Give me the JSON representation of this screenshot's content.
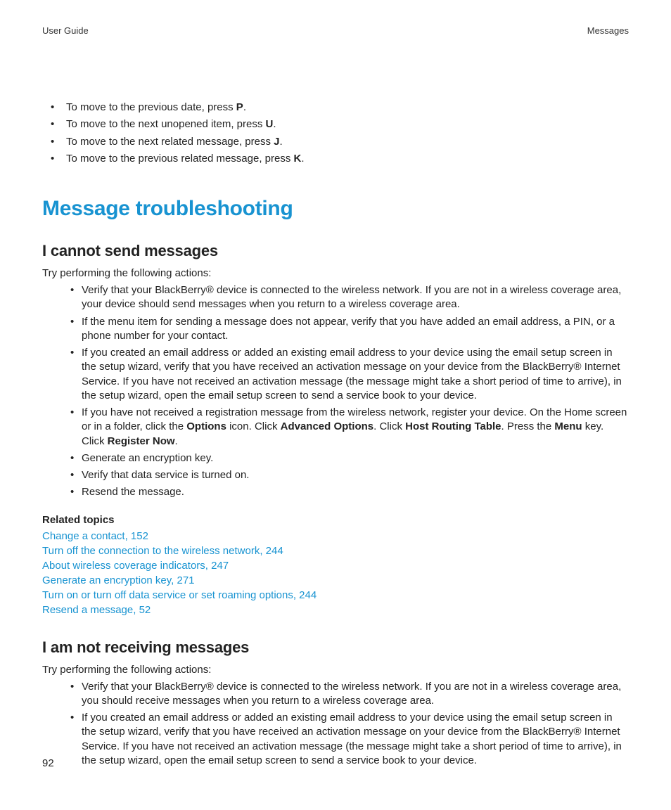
{
  "header": {
    "left": "User Guide",
    "right": "Messages"
  },
  "tips": [
    {
      "prefix": "To move to the previous date, press ",
      "key": "P",
      "suffix": "."
    },
    {
      "prefix": "To move to the next unopened item, press ",
      "key": "U",
      "suffix": "."
    },
    {
      "prefix": "To move to the next related message, press ",
      "key": "J",
      "suffix": "."
    },
    {
      "prefix": "To move to the previous related message, press ",
      "key": "K",
      "suffix": "."
    }
  ],
  "troubleshooting": {
    "title": "Message troubleshooting",
    "sections": [
      {
        "heading": "I cannot send messages",
        "intro": "Try performing the following actions:",
        "items": [
          {
            "text": "Verify that your BlackBerry® device is connected to the wireless network. If you are not in a wireless coverage area, your device should send messages when you return to a wireless coverage area."
          },
          {
            "text": "If the menu item for sending a message does not appear, verify that you have added an email address, a PIN, or a phone number for your contact."
          },
          {
            "text": "If you created an email address or added an existing email address to your device using the email setup screen in the setup wizard, verify that you have received an activation message on your device from the BlackBerry® Internet Service. If you have not received an activation message (the message might take a short period of time to arrive), in the setup wizard, open the email setup screen to send a service book to your device."
          },
          {
            "parts": [
              {
                "t": "If you have not received a registration message from the wireless network, register your device. On the Home screen or in a folder, click the "
              },
              {
                "t": "Options",
                "b": true
              },
              {
                "t": " icon. Click "
              },
              {
                "t": "Advanced Options",
                "b": true
              },
              {
                "t": ". Click "
              },
              {
                "t": "Host Routing Table",
                "b": true
              },
              {
                "t": ". Press the "
              },
              {
                "t": "Menu",
                "b": true
              },
              {
                "t": " key. Click "
              },
              {
                "t": "Register Now",
                "b": true
              },
              {
                "t": "."
              }
            ]
          },
          {
            "text": "Generate an encryption key."
          },
          {
            "text": "Verify that data service is turned on."
          },
          {
            "text": "Resend the message."
          }
        ],
        "related_heading": "Related topics",
        "related": [
          "Change a contact, 152",
          "Turn off the connection to the wireless network, 244",
          "About wireless coverage indicators, 247",
          "Generate an encryption key, 271",
          "Turn on or turn off data service or set roaming options, 244",
          "Resend a message, 52"
        ]
      },
      {
        "heading": "I am not receiving messages",
        "intro": "Try performing the following actions:",
        "items": [
          {
            "text": "Verify that your BlackBerry® device is connected to the wireless network. If you are not in a wireless coverage area, you should receive messages when you return to a wireless coverage area."
          },
          {
            "text": "If you created an email address or added an existing email address to your device using the email setup screen in the setup wizard, verify that you have received an activation message on your device from the BlackBerry® Internet Service. If you have not received an activation message (the message might take a short period of time to arrive), in the setup wizard, open the email setup screen to send a service book to your device."
          }
        ]
      }
    ]
  },
  "page_number": "92"
}
